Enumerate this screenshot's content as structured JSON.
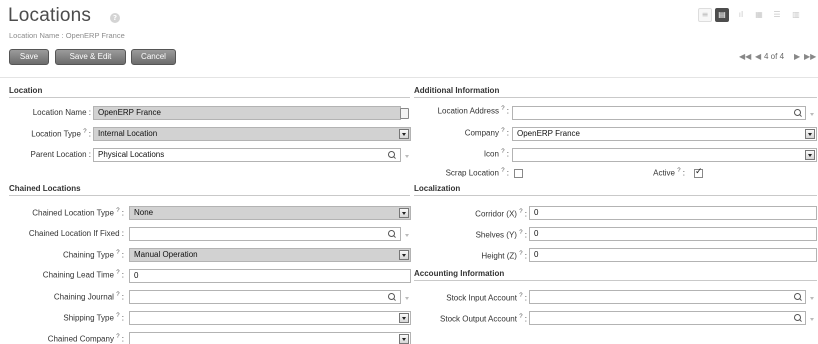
{
  "header": {
    "title": "Locations",
    "help": "?",
    "subtitle": "Location Name : OpenERP France"
  },
  "toolbar": {
    "save_label": "Save",
    "save_edit_label": "Save & Edit",
    "cancel_label": "Cancel"
  },
  "views": [
    "list-view-icon",
    "form-view-icon",
    "graph-view-icon",
    "calendar-view-icon",
    "gantt-view-icon",
    "diagram-view-icon"
  ],
  "pager": {
    "first": "◀◀",
    "prev": "◀",
    "status": "4 of 4",
    "next": "▶",
    "last": "▶▶"
  },
  "sections": {
    "location": "Location",
    "additional": "Additional Information",
    "chained": "Chained Locations",
    "localization": "Localization",
    "accounting": "Accounting Information"
  },
  "location": {
    "name_label": "Location Name :",
    "name_value": "OpenERP France",
    "type_label": "Location Type",
    "type_value": "Internal Location",
    "parent_label": "Parent Location :",
    "parent_value": "Physical Locations"
  },
  "additional": {
    "address_label": "Location Address",
    "address_value": "",
    "company_label": "Company",
    "company_value": "OpenERP France",
    "icon_label": "Icon",
    "icon_value": "",
    "scrap_label": "Scrap Location",
    "scrap_checked": false,
    "active_label": "Active",
    "active_checked": true
  },
  "chained": {
    "type_label": "Chained Location Type",
    "type_value": "None",
    "fixed_label": "Chained Location If Fixed :",
    "fixed_value": "",
    "chaining_type_label": "Chaining Type",
    "chaining_type_value": "Manual Operation",
    "lead_time_label": "Chaining Lead Time",
    "lead_time_value": "0",
    "journal_label": "Chaining Journal",
    "journal_value": "",
    "shipping_label": "Shipping Type",
    "shipping_value": "",
    "company_label": "Chained Company",
    "company_value": ""
  },
  "localization": {
    "corridor_label": "Corridor (X)",
    "corridor_value": "0",
    "shelves_label": "Shelves (Y)",
    "shelves_value": "0",
    "height_label": "Height (Z)",
    "height_value": "0"
  },
  "accounting": {
    "input_label": "Stock Input Account",
    "input_value": "",
    "output_label": "Stock Output Account",
    "output_value": ""
  },
  "help_mark": "?",
  "colon": ":"
}
